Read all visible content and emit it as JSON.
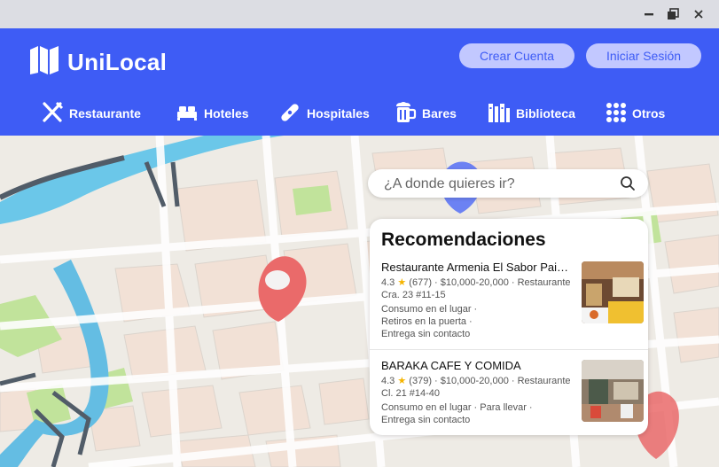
{
  "app": {
    "title": "UniLocal"
  },
  "window": {
    "minimize_icon": "minimize-icon",
    "restore_icon": "restore-icon",
    "close_icon": "close-icon"
  },
  "header": {
    "create_account": "Crear Cuenta",
    "login": "Iniciar Sesión",
    "accent": "#3e5cf5",
    "button_bg": "#c2c8ff"
  },
  "nav": {
    "items": [
      {
        "label": "Restaurante",
        "icon": "utensils-icon"
      },
      {
        "label": "Hoteles",
        "icon": "bed-icon"
      },
      {
        "label": "Hospitales",
        "icon": "bandage-icon"
      },
      {
        "label": "Bares",
        "icon": "beer-icon"
      },
      {
        "label": "Biblioteca",
        "icon": "books-icon"
      },
      {
        "label": "Otros",
        "icon": "grid-icon"
      }
    ]
  },
  "search": {
    "placeholder": "¿A donde quieres ir?"
  },
  "recommendations": {
    "title": "Recomendaciones",
    "items": [
      {
        "name": "Restaurante Armenia El Sabor Paisa Cafe",
        "rating": "4.3",
        "reviews": "(677)",
        "details": "· $10,000-20,000 · Restaurante",
        "address": "Cra. 23 #11-15",
        "services": [
          "Consumo en el lugar ·",
          "Retiros en la puerta ·",
          "Entrega sin contacto"
        ]
      },
      {
        "name": "BARAKA CAFE Y COMIDA",
        "rating": "4.3",
        "reviews": "(379)",
        "details": "· $10,000-20,000 · Restaurante",
        "address": "Cl. 21 #14-40",
        "services": [
          "Consumo en el lugar · Para llevar ·",
          "Entrega sin contacto"
        ]
      }
    ]
  }
}
